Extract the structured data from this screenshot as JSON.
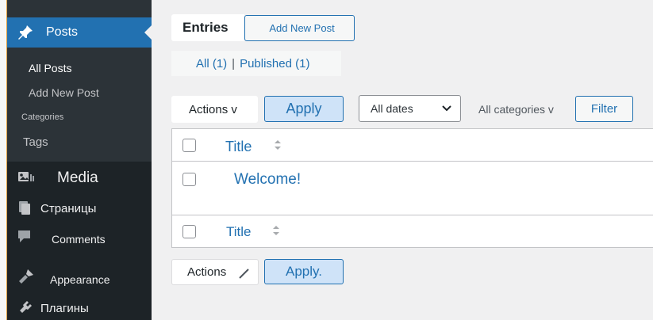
{
  "sidebar": {
    "posts_label": "Posts",
    "submenu": {
      "all_posts": "All Posts",
      "add_new_post": "Add New Post",
      "categories": "Categories",
      "tags": "Tags"
    },
    "items": [
      {
        "label": "Media",
        "icon": "media-icon"
      },
      {
        "label": "Страницы",
        "icon": "pages-icon"
      },
      {
        "label": "Comments",
        "icon": "comments-icon"
      },
      {
        "label": "Appearance",
        "icon": "appearance-icon"
      },
      {
        "label": "Плагины",
        "icon": "plugins-icon"
      }
    ]
  },
  "header": {
    "title": "Entries",
    "add_new_label": "Add New Post"
  },
  "filters": {
    "all": "All (1)",
    "separator": "|",
    "published": "Published (1)"
  },
  "top_actions": {
    "bulk_label": "Actions v",
    "apply_label": "Apply",
    "dates_select": "All dates",
    "categories_select": "All categories v",
    "filter_label": "Filter"
  },
  "table": {
    "header_title": "Title",
    "rows": [
      {
        "title": "Welcome!"
      }
    ],
    "footer_title": "Title"
  },
  "bottom_actions": {
    "bulk_label": "Actions",
    "apply_label": "Apply."
  },
  "colors": {
    "sidebar_bg": "#1d2327",
    "accent": "#2271b1",
    "page_bg": "#f0f0f1"
  }
}
